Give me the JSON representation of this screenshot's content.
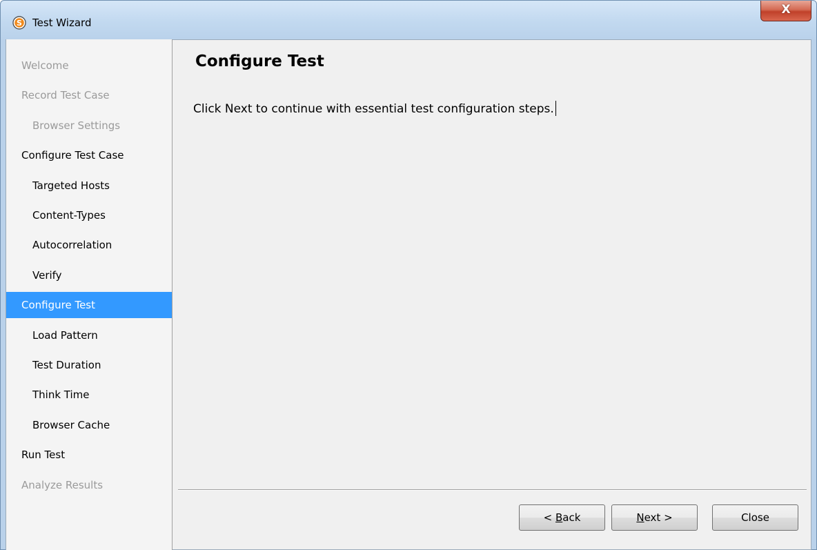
{
  "window": {
    "title": "Test Wizard",
    "close_glyph": "X",
    "app_icon_letter": "S",
    "app_icon_color": "#e8700a"
  },
  "sidebar": {
    "items": [
      {
        "label": "Welcome",
        "state": "disabled",
        "indent": 0
      },
      {
        "label": "Record Test Case",
        "state": "disabled",
        "indent": 0
      },
      {
        "label": "Browser Settings",
        "state": "disabled",
        "indent": 1
      },
      {
        "label": "Configure Test Case",
        "state": "enabled",
        "indent": 0
      },
      {
        "label": "Targeted Hosts",
        "state": "enabled",
        "indent": 1
      },
      {
        "label": "Content-Types",
        "state": "enabled",
        "indent": 1
      },
      {
        "label": "Autocorrelation",
        "state": "enabled",
        "indent": 1
      },
      {
        "label": "Verify",
        "state": "enabled",
        "indent": 1
      },
      {
        "label": "Configure Test",
        "state": "selected",
        "indent": 0
      },
      {
        "label": "Load Pattern",
        "state": "enabled",
        "indent": 1
      },
      {
        "label": "Test Duration",
        "state": "enabled",
        "indent": 1
      },
      {
        "label": "Think Time",
        "state": "enabled",
        "indent": 1
      },
      {
        "label": "Browser Cache",
        "state": "enabled",
        "indent": 1
      },
      {
        "label": "Run Test",
        "state": "enabled",
        "indent": 0
      },
      {
        "label": "Analyze Results",
        "state": "disabled",
        "indent": 0
      }
    ],
    "selected_color": "#3399ff"
  },
  "content": {
    "title": "Configure Test",
    "description": "Click Next to continue with essential test configuration steps."
  },
  "buttons": {
    "back_prefix": "< ",
    "back_mnemonic": "B",
    "back_rest": "ack",
    "next_mnemonic": "N",
    "next_rest": "ext >",
    "close_label": "Close"
  }
}
